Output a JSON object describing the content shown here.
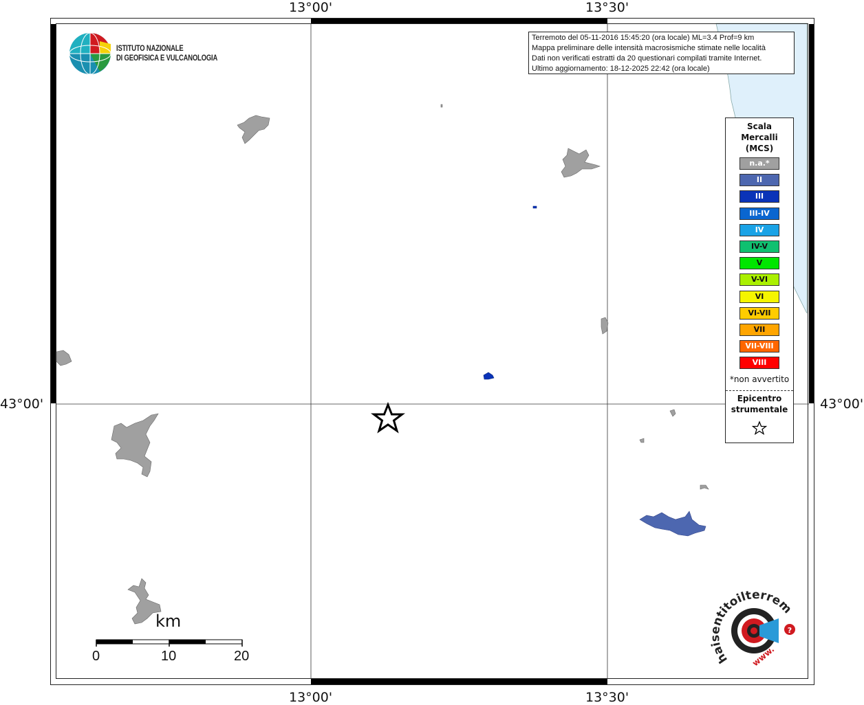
{
  "coords": {
    "top_left": "13°00'",
    "top_right": "13°30'",
    "bottom_left": "13°00'",
    "bottom_right": "13°30'",
    "left_lat": "43°00'",
    "right_lat": "43°00'"
  },
  "info": {
    "line1": "Terremoto del 05-11-2016 15:45:20 (ora locale) ML=3.4 Prof=9 km",
    "line2": "Mappa preliminare delle intensità macrosismiche stimate nelle località",
    "line3": "Dati non verificati estratti da 20 questionari compilati tramite Internet.",
    "line4": "Ultimo aggiornamento: 18-12-2025 22:42 (ora locale)"
  },
  "logo": {
    "line1": "ISTITUTO NAZIONALE",
    "line2": "DI GEOFISICA E VULCANOLOGIA",
    "icon": "ingv-globe-logo"
  },
  "legend": {
    "title1": "Scala",
    "title2": "Mercalli",
    "title3": "(MCS)",
    "items": [
      {
        "label": "n.a.*",
        "color": "#a0a0a0"
      },
      {
        "label": "II",
        "color": "#4d67b0"
      },
      {
        "label": "III",
        "color": "#0a33b8"
      },
      {
        "label": "III-IV",
        "color": "#0a66d0"
      },
      {
        "label": "IV",
        "color": "#1aa3e6"
      },
      {
        "label": "IV-V",
        "color": "#10c070"
      },
      {
        "label": "V",
        "color": "#00e600"
      },
      {
        "label": "V-VI",
        "color": "#aaf000"
      },
      {
        "label": "VI",
        "color": "#f5f500"
      },
      {
        "label": "VI-VII",
        "color": "#ffcc00"
      },
      {
        "label": "VII",
        "color": "#ffa500"
      },
      {
        "label": "VII-VIII",
        "color": "#ff6600"
      },
      {
        "label": "VIII",
        "color": "#ff0000"
      }
    ],
    "note": "*non avvertito",
    "epi1": "Epicentro",
    "epi2": "strumentale",
    "epi_icon": "star-icon"
  },
  "scale": {
    "unit": "km",
    "ticks": [
      "0",
      "10",
      "20"
    ]
  },
  "watermark": {
    "icon": "haisentitoilterremoto-logo",
    "text": "haisentitoilterremoto.it",
    "prefix": "www."
  },
  "colors": {
    "sea": "#dff0fb",
    "na_gray": "#a0a0a0",
    "intensity_II": "#4d67b0",
    "intensity_III": "#0a33b8"
  }
}
